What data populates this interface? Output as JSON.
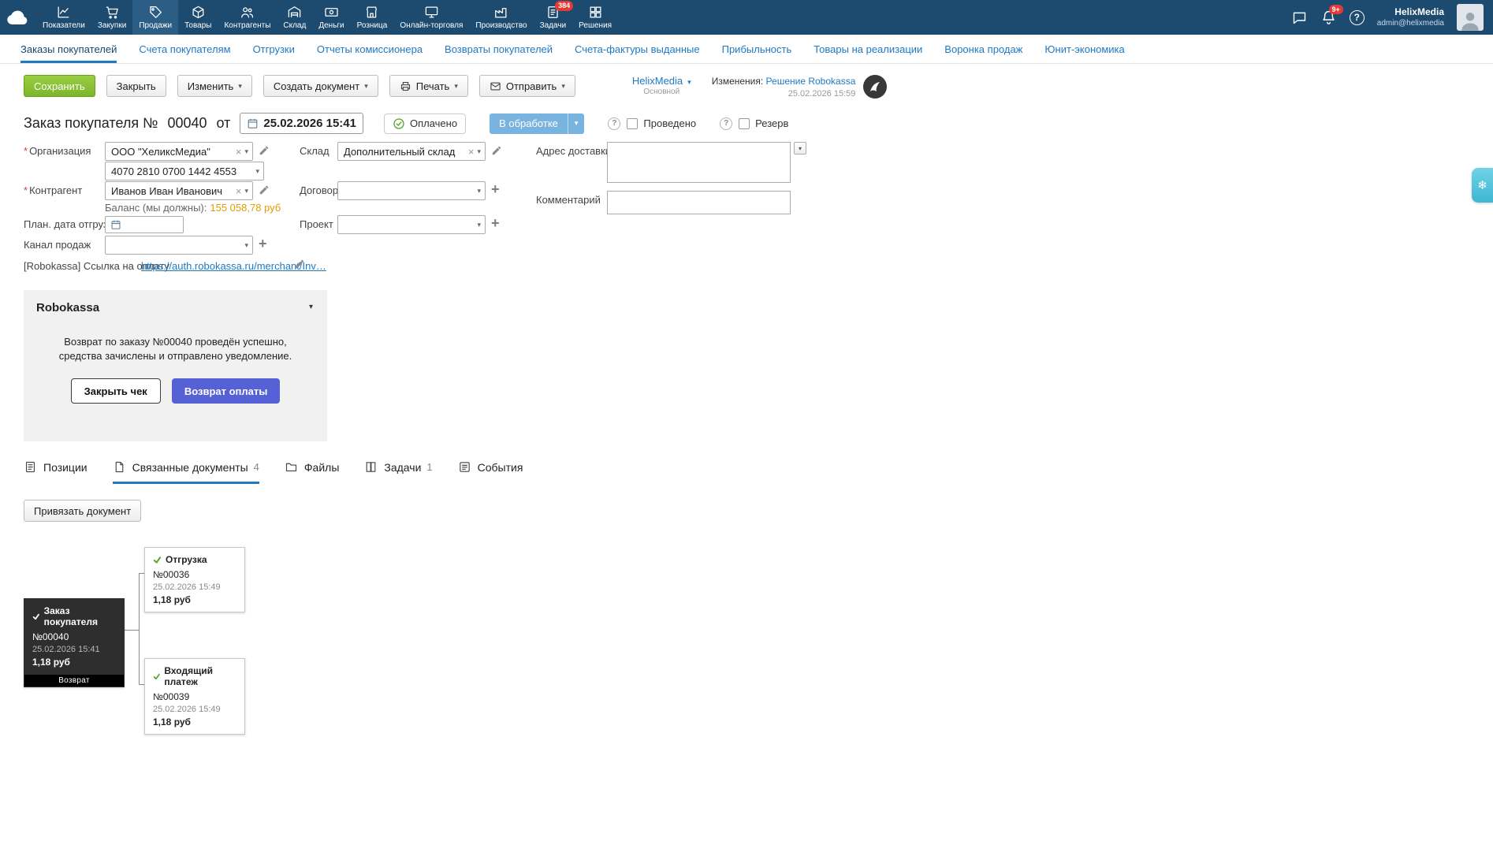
{
  "colors": {
    "topbar_bg": "#1d4a6f",
    "accent_blue": "#2079c3",
    "save_green": "#7cb52b",
    "status_blue": "#79b3e0",
    "refund_blue": "#5661d6",
    "balance_amber": "#df9d00",
    "check_green": "#52a829",
    "badge_red": "#e53935",
    "dark_card": "#2e2e2e",
    "promo_teal": "#3fb6d2"
  },
  "topbar": {
    "items": [
      "Показатели",
      "Закупки",
      "Продажи",
      "Товары",
      "Контрагенты",
      "Склад",
      "Деньги",
      "Розница",
      "Онлайн-торговля",
      "Производство",
      "Задачи",
      "Решения"
    ],
    "active_item": "Продажи",
    "tasks_badge": "384",
    "notifications_badge": "9+",
    "user": {
      "name": "HelixMedia",
      "email": "admin@helixmedia"
    }
  },
  "subnav": {
    "tabs": [
      "Заказы покупателей",
      "Счета покупателям",
      "Отгрузки",
      "Отчеты комиссионера",
      "Возвраты покупателей",
      "Счета-фактуры выданные",
      "Прибыльность",
      "Товары на реализации",
      "Воронка продаж",
      "Юнит-экономика"
    ],
    "active_tab": "Заказы покупателей"
  },
  "toolbar": {
    "save": "Сохранить",
    "close": "Закрыть",
    "edit": "Изменить",
    "create_doc": "Создать документ",
    "print": "Печать",
    "send": "Отправить"
  },
  "context": {
    "company": "HelixMedia",
    "branch": "Основной",
    "changes_label": "Изменения:",
    "changes_link": "Решение Robokassa",
    "changes_datetime": "25.02.2026 15:59"
  },
  "doc": {
    "title_prefix": "Заказ покупателя №",
    "number": "00040",
    "of_label": "от",
    "datetime": "25.02.2026 15:41",
    "paid_label": "Оплачено",
    "status_label": "В обработке",
    "conducted_label": "Проведено",
    "reserve_label": "Резерв"
  },
  "form": {
    "organization": {
      "label": "Организация",
      "value": "ООО \"ХеликсМедиа\""
    },
    "account": {
      "value": "4070 2810 0700 1442 4553"
    },
    "counterparty": {
      "label": "Контрагент",
      "value": "Иванов Иван Иванович"
    },
    "balance": {
      "label": "Баланс (мы должны):",
      "value": "155 058,78 руб"
    },
    "ship_date": {
      "label": "План. дата отгрузки"
    },
    "sales_channel": {
      "label": "Канал продаж"
    },
    "payment_link": {
      "label": "[Robokassa] Ссылка на оплату",
      "value": "https://auth.robokassa.ru/merchant/Inv…"
    },
    "warehouse": {
      "label": "Склад",
      "value": "Дополнительный склад"
    },
    "contract": {
      "label": "Договор"
    },
    "project": {
      "label": "Проект"
    },
    "delivery_address": {
      "label": "Адрес доставки"
    },
    "comment": {
      "label": "Комментарий"
    }
  },
  "robokassa": {
    "title": "Robokassa",
    "message": "Возврат по заказу №00040 проведён успешно, средства зачислены и отправлено уведомление.",
    "close_check": "Закрыть чек",
    "refund": "Возврат оплаты"
  },
  "detail_tabs": {
    "items": [
      {
        "label": "Позиции",
        "count": ""
      },
      {
        "label": "Связанные документы",
        "count": "4"
      },
      {
        "label": "Файлы",
        "count": ""
      },
      {
        "label": "Задачи",
        "count": "1"
      },
      {
        "label": "События",
        "count": ""
      }
    ],
    "active_tab": "Связанные документы"
  },
  "linked": {
    "bind_button": "Привязать документ",
    "root": {
      "type": "Заказ покупателя",
      "number": "№00040",
      "datetime": "25.02.2026 15:41",
      "amount": "1,18 руб",
      "tag": "Возврат"
    },
    "children": [
      {
        "type": "Отгрузка",
        "number": "№00036",
        "datetime": "25.02.2026 15:49",
        "amount": "1,18 руб"
      },
      {
        "type": "Входящий платеж",
        "number": "№00039",
        "datetime": "25.02.2026 15:49",
        "amount": "1,18 руб"
      }
    ]
  }
}
